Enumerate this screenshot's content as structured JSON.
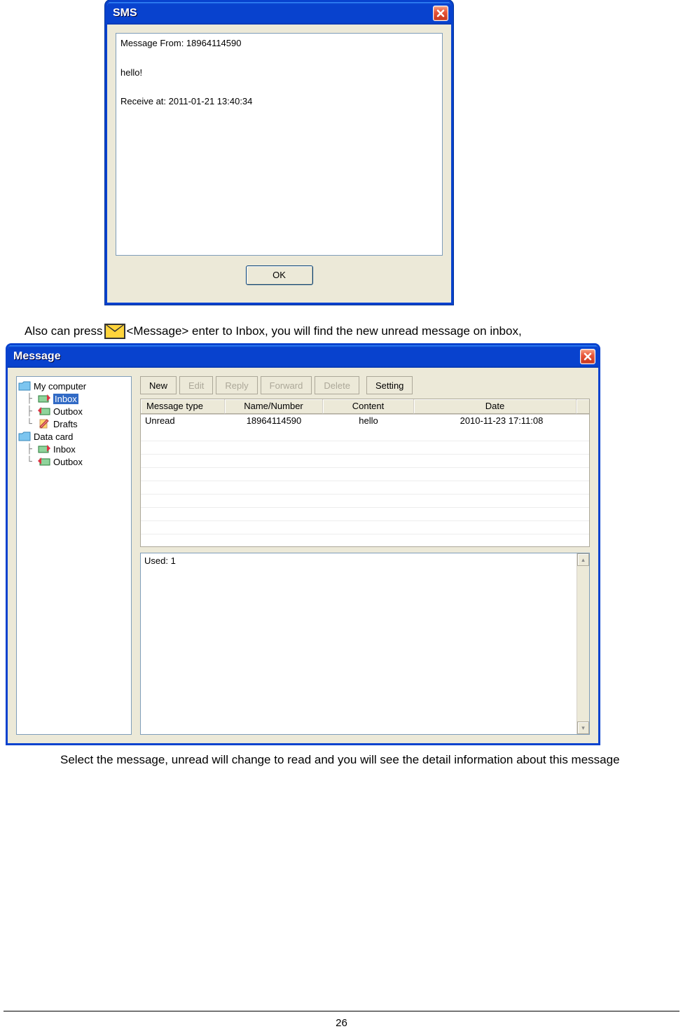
{
  "sms_dialog": {
    "title": "SMS",
    "content": "Message From: 18964114590\n\nhello!\n\nReceive at: 2011-01-21 13:40:34",
    "ok_label": "OK"
  },
  "para1_before": "Also can press",
  "para1_after": "<Message> enter to Inbox, you will find the new unread message on inbox,",
  "msg_window": {
    "title": "Message",
    "tree": {
      "root1": "My computer",
      "inbox1": "Inbox",
      "outbox1": "Outbox",
      "drafts": "Drafts",
      "root2": "Data card",
      "inbox2": "Inbox",
      "outbox2": "Outbox"
    },
    "toolbar": {
      "new": "New",
      "edit": "Edit",
      "reply": "Reply",
      "forward": "Forward",
      "delete": "Delete",
      "setting": "Setting"
    },
    "headers": {
      "type": "Message type",
      "name": "Name/Number",
      "content": "Content",
      "date": "Date"
    },
    "rows": [
      {
        "type": "Unread",
        "name": "18964114590",
        "content": "hello",
        "date": "2010-11-23 17:11:08"
      }
    ],
    "detail": "Used: 1"
  },
  "para2": "Select the message, unread will change to read and you will see the detail information about this message",
  "page_number": "26"
}
